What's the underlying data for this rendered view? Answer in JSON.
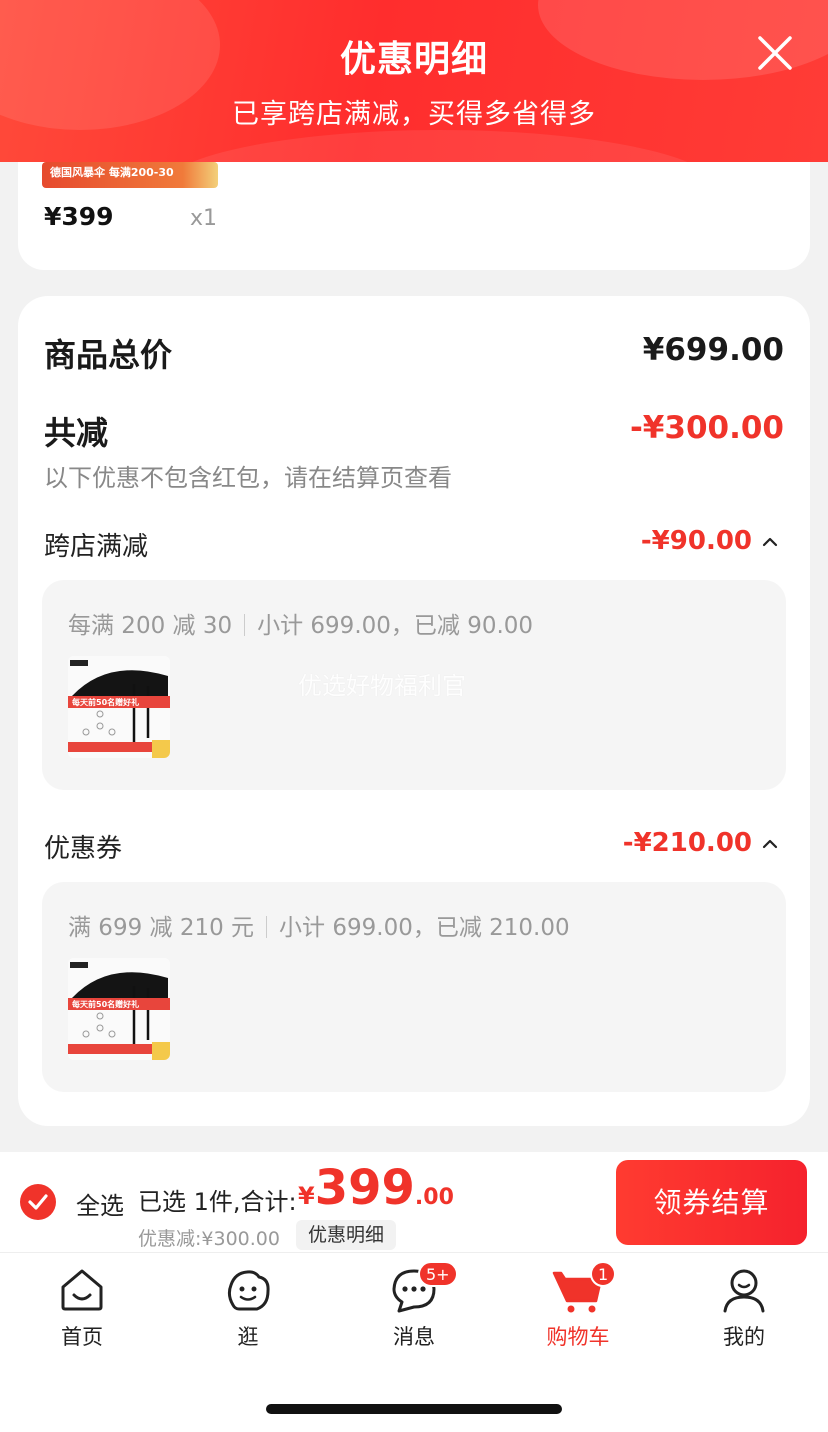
{
  "header": {
    "title": "优惠明细",
    "subtitle": "已享跨店满减，买得多省得多"
  },
  "product": {
    "banner_text": "德国风暴伞 每满200-30",
    "price": "¥399",
    "quantity": "x1"
  },
  "summary": {
    "total_label": "商品总价",
    "total_value": "¥699.00",
    "reduce_label": "共减",
    "reduce_value": "-¥300.00",
    "note": "以下优惠不包含红包，请在结算页查看",
    "sections": [
      {
        "label": "跨店满减",
        "value": "-¥90.00",
        "rule": "每满 200 减 30",
        "detail": "小计 699.00，已减 90.00",
        "watermark": "优选好物福利官"
      },
      {
        "label": "优惠券",
        "value": "-¥210.00",
        "rule": "满 699 减 210 元",
        "detail": "小计 699.00，已减 210.00"
      }
    ]
  },
  "checkout": {
    "select_all": "全选",
    "selected_text": "已选 1件,合计:",
    "currency": "¥",
    "total_int": "399",
    "total_dec": ".00",
    "discount_text": "优惠减:¥300.00",
    "detail_chip": "优惠明细",
    "button": "领券结算"
  },
  "tabs": [
    {
      "label": "首页",
      "icon": "home-icon"
    },
    {
      "label": "逛",
      "icon": "browse-icon"
    },
    {
      "label": "消息",
      "icon": "message-icon",
      "badge": "5+"
    },
    {
      "label": "购物车",
      "icon": "cart-icon",
      "badge": "1",
      "active": true
    },
    {
      "label": "我的",
      "icon": "profile-icon"
    }
  ],
  "colors": {
    "accent": "#f0332a",
    "header_red": "#ff2d2d"
  }
}
